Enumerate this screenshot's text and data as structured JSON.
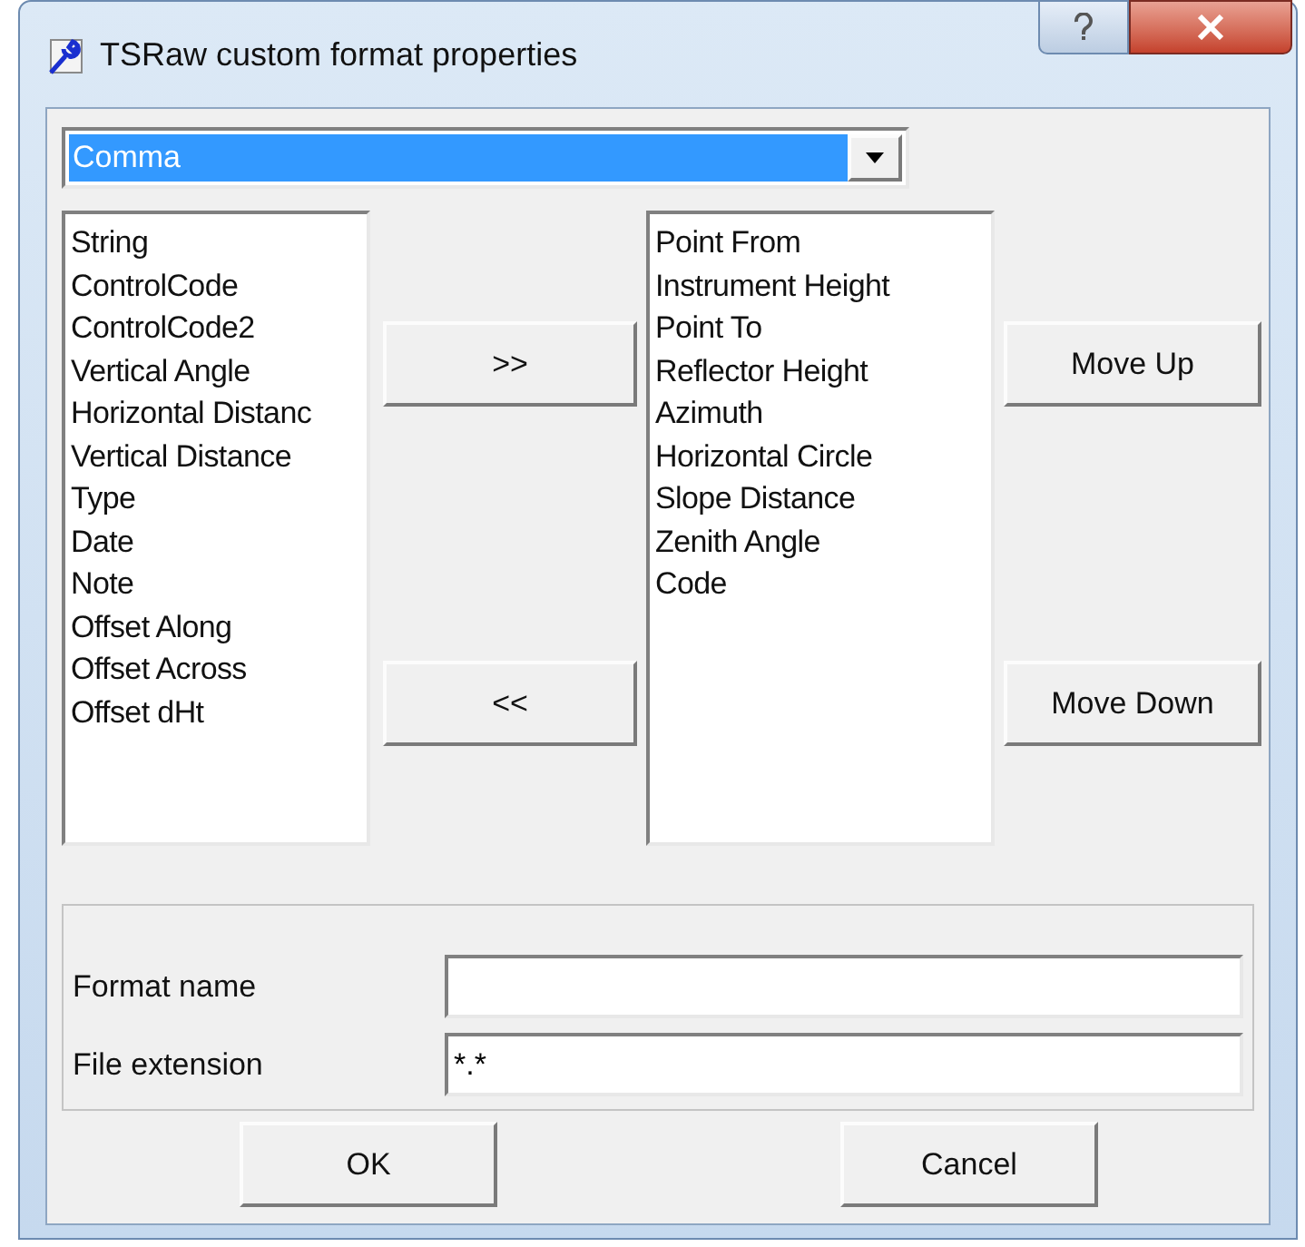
{
  "window": {
    "title": "TSRaw custom format properties"
  },
  "delimiter_combo": {
    "value": "Comma"
  },
  "available_fields": [
    "String",
    "ControlCode",
    "ControlCode2",
    "Vertical Angle",
    "Horizontal Distanc",
    "Vertical Distance",
    "Type",
    "Date",
    "Note",
    "Offset Along",
    "Offset Across",
    "Offset dHt"
  ],
  "transfer_buttons": [
    ">>",
    "<<"
  ],
  "selected_fields": [
    "Point From",
    "Instrument Height",
    "Point To",
    "Reflector Height",
    "Azimuth",
    "Horizontal Circle",
    "Slope Distance",
    "Zenith Angle",
    "Code"
  ],
  "order_buttons": [
    "Move Up",
    "Move Down"
  ],
  "form": [
    {
      "label": "Format name"
    },
    {
      "label": "File extension",
      "value": "*.*"
    }
  ],
  "buttons": [
    "OK",
    "Cancel"
  ]
}
